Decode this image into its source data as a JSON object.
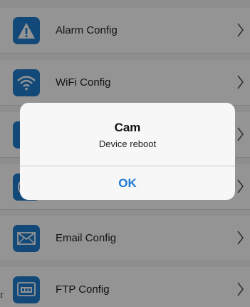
{
  "menu": {
    "items": [
      {
        "label": "Alarm Config",
        "icon": "warning-icon"
      },
      {
        "label": "WiFi Config",
        "icon": "wifi-icon"
      },
      {
        "label": "",
        "icon": "generic-icon"
      },
      {
        "label": "",
        "icon": "clock-icon"
      },
      {
        "label": "Email Config",
        "icon": "envelope-icon"
      },
      {
        "label": "FTP Config",
        "icon": "ftp-icon"
      }
    ]
  },
  "dialog": {
    "title": "Cam",
    "message": "Device reboot",
    "ok_label": "OK"
  },
  "edge_fragment": "r",
  "colors": {
    "icon_bg": "#1f7fd1",
    "button_text": "#1f7ad6"
  }
}
